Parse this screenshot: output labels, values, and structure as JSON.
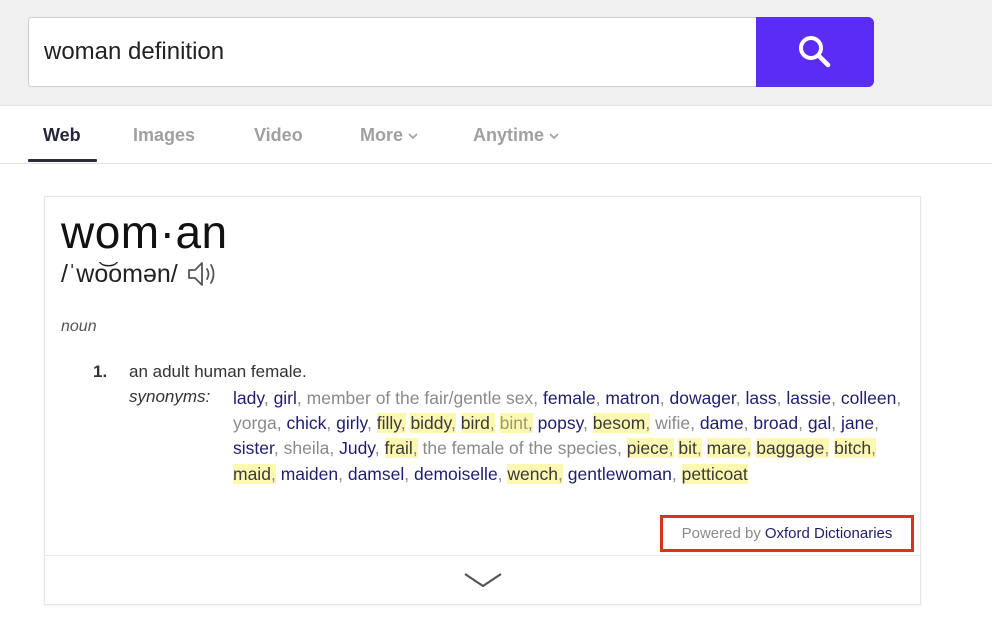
{
  "search": {
    "query": "woman definition",
    "button_icon": "search-icon",
    "accent_color": "#5b2cf6"
  },
  "tabs": [
    {
      "label": "Web",
      "active": true
    },
    {
      "label": "Images",
      "active": false
    },
    {
      "label": "Video",
      "active": false
    },
    {
      "label": "More",
      "active": false,
      "dropdown": true
    },
    {
      "label": "Anytime",
      "active": false,
      "dropdown": true
    }
  ],
  "entry": {
    "headword": "wom·an",
    "phonetic": "/ˈwo͝omən/",
    "audio_icon": "speaker-icon",
    "part_of_speech": "noun",
    "senses": [
      {
        "number": "1.",
        "definition": "an adult human female.",
        "synonyms_label": "synonyms:",
        "synonyms": [
          {
            "text": "lady",
            "link": true,
            "highlight": false
          },
          {
            "text": "girl",
            "link": true,
            "highlight": false
          },
          {
            "text": "member of the fair/gentle sex",
            "link": false,
            "highlight": false
          },
          {
            "text": "female",
            "link": true,
            "highlight": false
          },
          {
            "text": "matron",
            "link": true,
            "highlight": false
          },
          {
            "text": "dowager",
            "link": true,
            "highlight": false
          },
          {
            "text": "lass",
            "link": true,
            "highlight": false
          },
          {
            "text": "lassie",
            "link": true,
            "highlight": false
          },
          {
            "text": "colleen",
            "link": true,
            "highlight": false
          },
          {
            "text": "yorga",
            "link": false,
            "highlight": false
          },
          {
            "text": "chick",
            "link": true,
            "highlight": false
          },
          {
            "text": "girly",
            "link": true,
            "highlight": false
          },
          {
            "text": "filly",
            "link": true,
            "highlight": true
          },
          {
            "text": "biddy",
            "link": true,
            "highlight": true
          },
          {
            "text": "bird",
            "link": true,
            "highlight": true
          },
          {
            "text": "bint",
            "link": false,
            "highlight": true
          },
          {
            "text": "popsy",
            "link": true,
            "highlight": false
          },
          {
            "text": "besom",
            "link": true,
            "highlight": true
          },
          {
            "text": "wifie",
            "link": false,
            "highlight": false
          },
          {
            "text": "dame",
            "link": true,
            "highlight": false
          },
          {
            "text": "broad",
            "link": true,
            "highlight": false
          },
          {
            "text": "gal",
            "link": true,
            "highlight": false
          },
          {
            "text": "jane",
            "link": true,
            "highlight": false
          },
          {
            "text": "sister",
            "link": true,
            "highlight": false
          },
          {
            "text": "sheila",
            "link": false,
            "highlight": false
          },
          {
            "text": "Judy",
            "link": true,
            "highlight": false
          },
          {
            "text": "frail",
            "link": true,
            "highlight": true
          },
          {
            "text": "the female of the species",
            "link": false,
            "highlight": false
          },
          {
            "text": "piece",
            "link": true,
            "highlight": true
          },
          {
            "text": "bit",
            "link": true,
            "highlight": true
          },
          {
            "text": "mare",
            "link": true,
            "highlight": true
          },
          {
            "text": "baggage",
            "link": true,
            "highlight": true
          },
          {
            "text": "bitch",
            "link": true,
            "highlight": true
          },
          {
            "text": "maid",
            "link": true,
            "highlight": true
          },
          {
            "text": "maiden",
            "link": true,
            "highlight": false
          },
          {
            "text": "damsel",
            "link": true,
            "highlight": false
          },
          {
            "text": "demoiselle",
            "link": true,
            "highlight": false
          },
          {
            "text": "wench",
            "link": true,
            "highlight": true
          },
          {
            "text": "gentlewoman",
            "link": true,
            "highlight": false
          },
          {
            "text": "petticoat",
            "link": true,
            "highlight": true
          }
        ]
      }
    ],
    "attribution": {
      "prefix": "Powered by",
      "source": "Oxford Dictionaries",
      "annotation_color": "#d8331f"
    },
    "expand_icon": "chevron-down-icon"
  },
  "colors": {
    "link": "#1f1e6e",
    "plain_synonym": "#8a8a8a",
    "highlight": "#fcf8b2"
  }
}
